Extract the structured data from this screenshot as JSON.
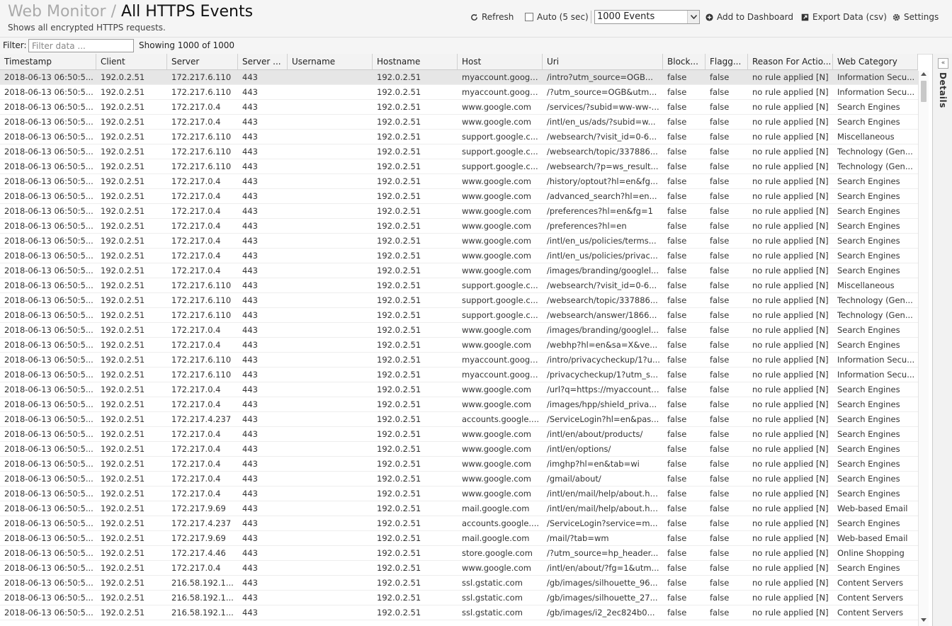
{
  "header": {
    "breadcrumb_parent": "Web Monitor",
    "breadcrumb_separator": "/",
    "title": "All HTTPS Events",
    "subtitle": "Shows all encrypted HTTPS requests."
  },
  "toolbar": {
    "refresh_label": "Refresh",
    "auto_label": "Auto (5 sec)",
    "events_select_value": "1000 Events",
    "add_dashboard_label": "Add to Dashboard",
    "export_label": "Export Data (csv)",
    "settings_label": "Settings"
  },
  "filter": {
    "label": "Filter:",
    "placeholder": "Filter data ...",
    "showing": "Showing 1000 of 1000"
  },
  "details": {
    "label": "Details"
  },
  "table": {
    "columns": [
      "Timestamp",
      "Client",
      "Server",
      "Server ...",
      "Username",
      "Hostname",
      "Host",
      "Uri",
      "Block...",
      "Flagg...",
      "Reason For Actio...",
      "Web Category"
    ],
    "rows": [
      [
        "2018-06-13 06:50:5...",
        "192.0.2.51",
        "172.217.6.110",
        "443",
        "",
        "192.0.2.51",
        "myaccount.googl...",
        "/intro?utm_source=OGB...",
        "false",
        "false",
        "no rule applied [N]",
        "Information Secu..."
      ],
      [
        "2018-06-13 06:50:5...",
        "192.0.2.51",
        "172.217.6.110",
        "443",
        "",
        "192.0.2.51",
        "myaccount.googl...",
        "/?utm_source=OGB&utm...",
        "false",
        "false",
        "no rule applied [N]",
        "Information Secu..."
      ],
      [
        "2018-06-13 06:50:5...",
        "192.0.2.51",
        "172.217.0.4",
        "443",
        "",
        "192.0.2.51",
        "www.google.com",
        "/services/?subid=ww-ww-...",
        "false",
        "false",
        "no rule applied [N]",
        "Search Engines"
      ],
      [
        "2018-06-13 06:50:5...",
        "192.0.2.51",
        "172.217.0.4",
        "443",
        "",
        "192.0.2.51",
        "www.google.com",
        "/intl/en_us/ads/?subid=w...",
        "false",
        "false",
        "no rule applied [N]",
        "Search Engines"
      ],
      [
        "2018-06-13 06:50:5...",
        "192.0.2.51",
        "172.217.6.110",
        "443",
        "",
        "192.0.2.51",
        "support.google.c...",
        "/websearch/?visit_id=0-6...",
        "false",
        "false",
        "no rule applied [N]",
        "Miscellaneous"
      ],
      [
        "2018-06-13 06:50:5...",
        "192.0.2.51",
        "172.217.6.110",
        "443",
        "",
        "192.0.2.51",
        "support.google.c...",
        "/websearch/topic/337886...",
        "false",
        "false",
        "no rule applied [N]",
        "Technology (Gen..."
      ],
      [
        "2018-06-13 06:50:5...",
        "192.0.2.51",
        "172.217.6.110",
        "443",
        "",
        "192.0.2.51",
        "support.google.c...",
        "/websearch/?p=ws_result...",
        "false",
        "false",
        "no rule applied [N]",
        "Technology (Gen..."
      ],
      [
        "2018-06-13 06:50:5...",
        "192.0.2.51",
        "172.217.0.4",
        "443",
        "",
        "192.0.2.51",
        "www.google.com",
        "/history/optout?hl=en&fg...",
        "false",
        "false",
        "no rule applied [N]",
        "Search Engines"
      ],
      [
        "2018-06-13 06:50:5...",
        "192.0.2.51",
        "172.217.0.4",
        "443",
        "",
        "192.0.2.51",
        "www.google.com",
        "/advanced_search?hl=en...",
        "false",
        "false",
        "no rule applied [N]",
        "Search Engines"
      ],
      [
        "2018-06-13 06:50:5...",
        "192.0.2.51",
        "172.217.0.4",
        "443",
        "",
        "192.0.2.51",
        "www.google.com",
        "/preferences?hl=en&fg=1",
        "false",
        "false",
        "no rule applied [N]",
        "Search Engines"
      ],
      [
        "2018-06-13 06:50:5...",
        "192.0.2.51",
        "172.217.0.4",
        "443",
        "",
        "192.0.2.51",
        "www.google.com",
        "/preferences?hl=en",
        "false",
        "false",
        "no rule applied [N]",
        "Search Engines"
      ],
      [
        "2018-06-13 06:50:5...",
        "192.0.2.51",
        "172.217.0.4",
        "443",
        "",
        "192.0.2.51",
        "www.google.com",
        "/intl/en_us/policies/terms...",
        "false",
        "false",
        "no rule applied [N]",
        "Search Engines"
      ],
      [
        "2018-06-13 06:50:5...",
        "192.0.2.51",
        "172.217.0.4",
        "443",
        "",
        "192.0.2.51",
        "www.google.com",
        "/intl/en_us/policies/privac...",
        "false",
        "false",
        "no rule applied [N]",
        "Search Engines"
      ],
      [
        "2018-06-13 06:50:5...",
        "192.0.2.51",
        "172.217.0.4",
        "443",
        "",
        "192.0.2.51",
        "www.google.com",
        "/images/branding/googlel...",
        "false",
        "false",
        "no rule applied [N]",
        "Search Engines"
      ],
      [
        "2018-06-13 06:50:5...",
        "192.0.2.51",
        "172.217.6.110",
        "443",
        "",
        "192.0.2.51",
        "support.google.c...",
        "/websearch/?visit_id=0-6...",
        "false",
        "false",
        "no rule applied [N]",
        "Miscellaneous"
      ],
      [
        "2018-06-13 06:50:5...",
        "192.0.2.51",
        "172.217.6.110",
        "443",
        "",
        "192.0.2.51",
        "support.google.c...",
        "/websearch/topic/337886...",
        "false",
        "false",
        "no rule applied [N]",
        "Technology (Gen..."
      ],
      [
        "2018-06-13 06:50:5...",
        "192.0.2.51",
        "172.217.6.110",
        "443",
        "",
        "192.0.2.51",
        "support.google.c...",
        "/websearch/answer/1866...",
        "false",
        "false",
        "no rule applied [N]",
        "Technology (Gen..."
      ],
      [
        "2018-06-13 06:50:5...",
        "192.0.2.51",
        "172.217.0.4",
        "443",
        "",
        "192.0.2.51",
        "www.google.com",
        "/images/branding/googlel...",
        "false",
        "false",
        "no rule applied [N]",
        "Search Engines"
      ],
      [
        "2018-06-13 06:50:5...",
        "192.0.2.51",
        "172.217.0.4",
        "443",
        "",
        "192.0.2.51",
        "www.google.com",
        "/webhp?hl=en&sa=X&ve...",
        "false",
        "false",
        "no rule applied [N]",
        "Search Engines"
      ],
      [
        "2018-06-13 06:50:5...",
        "192.0.2.51",
        "172.217.6.110",
        "443",
        "",
        "192.0.2.51",
        "myaccount.googl...",
        "/intro/privacycheckup/1?u...",
        "false",
        "false",
        "no rule applied [N]",
        "Information Secu..."
      ],
      [
        "2018-06-13 06:50:5...",
        "192.0.2.51",
        "172.217.6.110",
        "443",
        "",
        "192.0.2.51",
        "myaccount.googl...",
        "/privacycheckup/1?utm_s...",
        "false",
        "false",
        "no rule applied [N]",
        "Information Secu..."
      ],
      [
        "2018-06-13 06:50:5...",
        "192.0.2.51",
        "172.217.0.4",
        "443",
        "",
        "192.0.2.51",
        "www.google.com",
        "/url?q=https://myaccount....",
        "false",
        "false",
        "no rule applied [N]",
        "Search Engines"
      ],
      [
        "2018-06-13 06:50:5...",
        "192.0.2.51",
        "172.217.0.4",
        "443",
        "",
        "192.0.2.51",
        "www.google.com",
        "/images/hpp/shield_priva...",
        "false",
        "false",
        "no rule applied [N]",
        "Search Engines"
      ],
      [
        "2018-06-13 06:50:5...",
        "192.0.2.51",
        "172.217.4.237",
        "443",
        "",
        "192.0.2.51",
        "accounts.google....",
        "/ServiceLogin?hl=en&pas...",
        "false",
        "false",
        "no rule applied [N]",
        "Search Engines"
      ],
      [
        "2018-06-13 06:50:5...",
        "192.0.2.51",
        "172.217.0.4",
        "443",
        "",
        "192.0.2.51",
        "www.google.com",
        "/intl/en/about/products/",
        "false",
        "false",
        "no rule applied [N]",
        "Search Engines"
      ],
      [
        "2018-06-13 06:50:5...",
        "192.0.2.51",
        "172.217.0.4",
        "443",
        "",
        "192.0.2.51",
        "www.google.com",
        "/intl/en/options/",
        "false",
        "false",
        "no rule applied [N]",
        "Search Engines"
      ],
      [
        "2018-06-13 06:50:5...",
        "192.0.2.51",
        "172.217.0.4",
        "443",
        "",
        "192.0.2.51",
        "www.google.com",
        "/imghp?hl=en&tab=wi",
        "false",
        "false",
        "no rule applied [N]",
        "Search Engines"
      ],
      [
        "2018-06-13 06:50:5...",
        "192.0.2.51",
        "172.217.0.4",
        "443",
        "",
        "192.0.2.51",
        "www.google.com",
        "/gmail/about/",
        "false",
        "false",
        "no rule applied [N]",
        "Search Engines"
      ],
      [
        "2018-06-13 06:50:5...",
        "192.0.2.51",
        "172.217.0.4",
        "443",
        "",
        "192.0.2.51",
        "www.google.com",
        "/intl/en/mail/help/about.ht...",
        "false",
        "false",
        "no rule applied [N]",
        "Search Engines"
      ],
      [
        "2018-06-13 06:50:5...",
        "192.0.2.51",
        "172.217.9.69",
        "443",
        "",
        "192.0.2.51",
        "mail.google.com",
        "/intl/en/mail/help/about.ht...",
        "false",
        "false",
        "no rule applied [N]",
        "Web-based Email"
      ],
      [
        "2018-06-13 06:50:5...",
        "192.0.2.51",
        "172.217.4.237",
        "443",
        "",
        "192.0.2.51",
        "accounts.google....",
        "/ServiceLogin?service=m...",
        "false",
        "false",
        "no rule applied [N]",
        "Search Engines"
      ],
      [
        "2018-06-13 06:50:5...",
        "192.0.2.51",
        "172.217.9.69",
        "443",
        "",
        "192.0.2.51",
        "mail.google.com",
        "/mail/?tab=wm",
        "false",
        "false",
        "no rule applied [N]",
        "Web-based Email"
      ],
      [
        "2018-06-13 06:50:5...",
        "192.0.2.51",
        "172.217.4.46",
        "443",
        "",
        "192.0.2.51",
        "store.google.com",
        "/?utm_source=hp_header...",
        "false",
        "false",
        "no rule applied [N]",
        "Online Shopping"
      ],
      [
        "2018-06-13 06:50:5...",
        "192.0.2.51",
        "172.217.0.4",
        "443",
        "",
        "192.0.2.51",
        "www.google.com",
        "/intl/en/about/?fg=1&utm...",
        "false",
        "false",
        "no rule applied [N]",
        "Search Engines"
      ],
      [
        "2018-06-13 06:50:5...",
        "192.0.2.51",
        "216.58.192.1...",
        "443",
        "",
        "192.0.2.51",
        "ssl.gstatic.com",
        "/gb/images/silhouette_96...",
        "false",
        "false",
        "no rule applied [N]",
        "Content Servers"
      ],
      [
        "2018-06-13 06:50:5...",
        "192.0.2.51",
        "216.58.192.1...",
        "443",
        "",
        "192.0.2.51",
        "ssl.gstatic.com",
        "/gb/images/silhouette_27...",
        "false",
        "false",
        "no rule applied [N]",
        "Content Servers"
      ],
      [
        "2018-06-13 06:50:5...",
        "192.0.2.51",
        "216.58.192.1...",
        "443",
        "",
        "192.0.2.51",
        "ssl.gstatic.com",
        "/gb/images/i2_2ec824b0...",
        "false",
        "false",
        "no rule applied [N]",
        "Content Servers"
      ]
    ]
  }
}
